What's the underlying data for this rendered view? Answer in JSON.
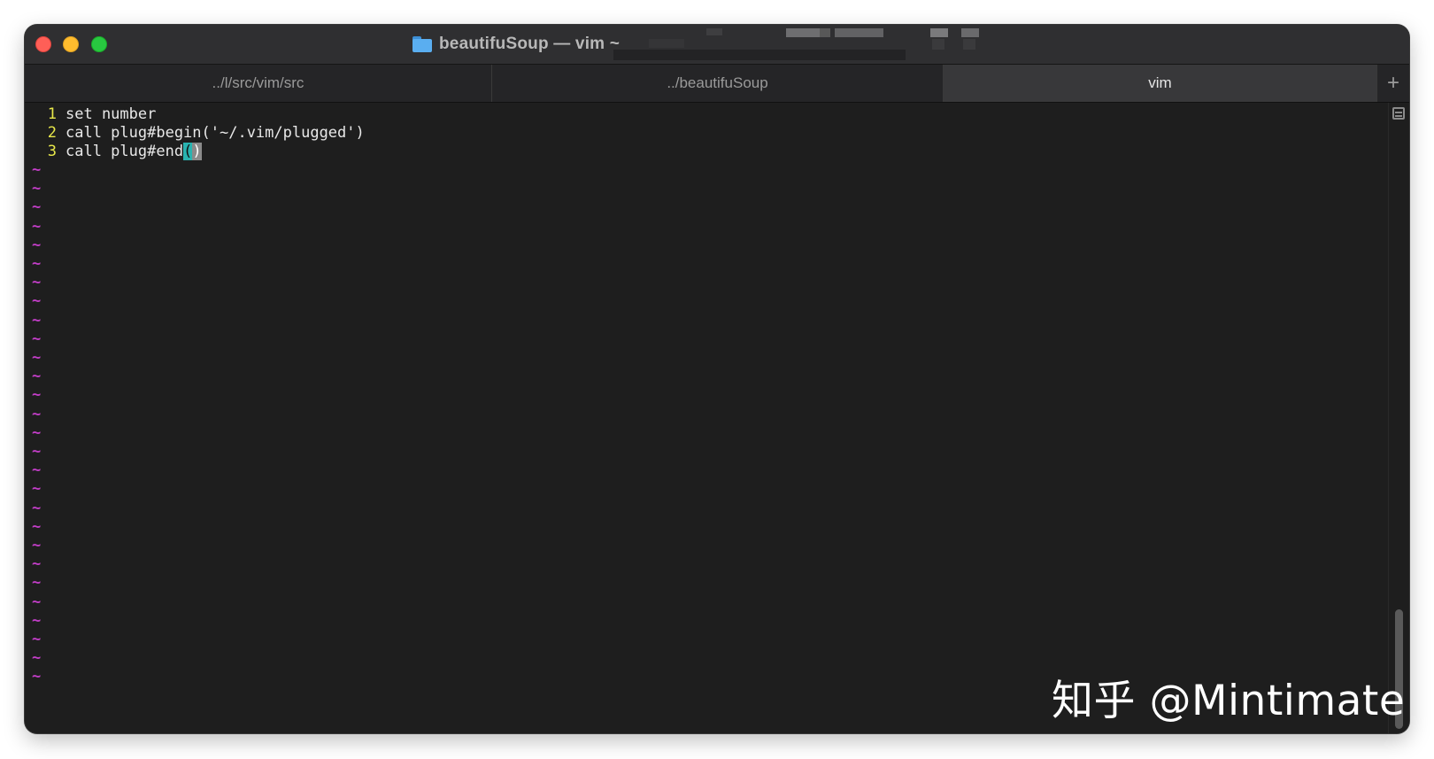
{
  "window": {
    "title": "beautifuSoup — vim ~",
    "folder_icon": "folder-icon",
    "colors": {
      "close": "#fe5f57",
      "minimize": "#febc2e",
      "maximize": "#28c840",
      "background": "#1e1e1e",
      "line_number": "#e8e84a",
      "tilde": "#c33ec8",
      "cursor": "#29b3b0"
    }
  },
  "tabs": [
    {
      "label": "../l/src/vim/src",
      "active": false
    },
    {
      "label": "../beautifuSoup",
      "active": false
    },
    {
      "label": "vim",
      "active": true
    }
  ],
  "tab_add_label": "+",
  "editor": {
    "lines": [
      {
        "num": "1",
        "text": "set number"
      },
      {
        "num": "2",
        "text": "call plug#begin('~/.vim/plugged')"
      },
      {
        "num": "3",
        "text_before": "call plug#end",
        "cursor_char": "(",
        "match_char": ")"
      }
    ],
    "tilde": "~",
    "tilde_count": 28
  },
  "watermark": "知乎 @Mintimate"
}
